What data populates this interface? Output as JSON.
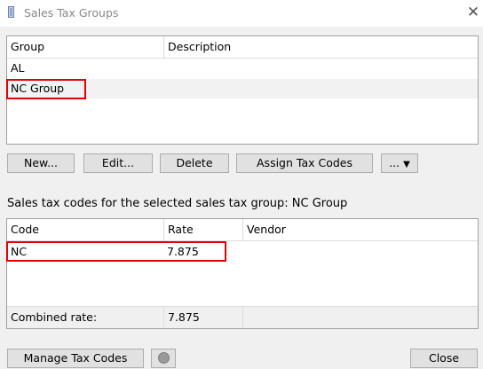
{
  "window": {
    "title": "Sales Tax Groups",
    "close_icon": "close-icon"
  },
  "groups_table": {
    "columns": [
      "Group",
      "Description"
    ],
    "rows": [
      {
        "group": "AL",
        "description": ""
      },
      {
        "group": "NC Group",
        "description": ""
      }
    ],
    "selected_row": "NC Group"
  },
  "group_buttons": {
    "new": "New...",
    "edit": "Edit...",
    "delete": "Delete",
    "assign": "Assign Tax Codes",
    "more": "...",
    "more_arrow": "▼"
  },
  "codes_section": {
    "label": "Sales tax codes for the selected sales tax group: NC Group"
  },
  "codes_table": {
    "columns": [
      "Code",
      "Rate",
      "Vendor"
    ],
    "rows": [
      {
        "code": "NC",
        "rate": "7.875",
        "vendor": ""
      }
    ],
    "footer": {
      "label": "Combined rate:",
      "rate": "7.875"
    }
  },
  "bottom_buttons": {
    "manage": "Manage Tax Codes",
    "close": "Close"
  }
}
